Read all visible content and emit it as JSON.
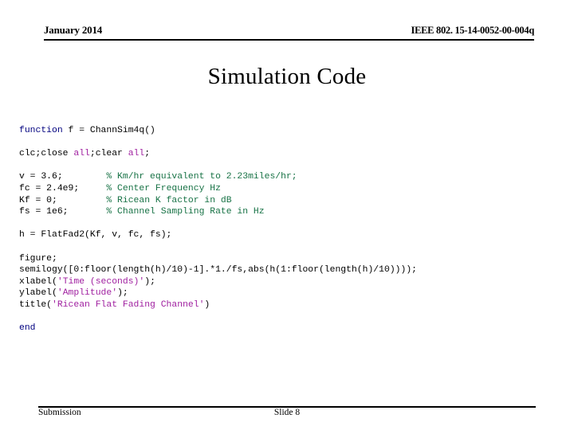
{
  "header": {
    "date": "January 2014",
    "doc_id": "IEEE 802. 15-14-0052-00-004q"
  },
  "title": "Simulation Code",
  "code": {
    "lines": [
      {
        "type": "code",
        "spans": [
          {
            "text": "function",
            "style": "kw"
          },
          {
            "text": " f = ChannSim4q()",
            "style": "plain"
          }
        ]
      },
      {
        "type": "blank"
      },
      {
        "type": "code",
        "spans": [
          {
            "text": "clc;close ",
            "style": "plain"
          },
          {
            "text": "all",
            "style": "str"
          },
          {
            "text": ";clear ",
            "style": "plain"
          },
          {
            "text": "all",
            "style": "str"
          },
          {
            "text": ";",
            "style": "plain"
          }
        ]
      },
      {
        "type": "blank"
      },
      {
        "type": "code",
        "spans": [
          {
            "text": "v = 3.6;        ",
            "style": "plain"
          },
          {
            "text": "% Km/hr equivalent to 2.23miles/hr;",
            "style": "cmt"
          }
        ]
      },
      {
        "type": "code",
        "spans": [
          {
            "text": "fc = 2.4e9;     ",
            "style": "plain"
          },
          {
            "text": "% Center Frequency Hz",
            "style": "cmt"
          }
        ]
      },
      {
        "type": "code",
        "spans": [
          {
            "text": "Kf = 0;         ",
            "style": "plain"
          },
          {
            "text": "% Ricean K factor in dB",
            "style": "cmt"
          }
        ]
      },
      {
        "type": "code",
        "spans": [
          {
            "text": "fs = 1e6;       ",
            "style": "plain"
          },
          {
            "text": "% Channel Sampling Rate in Hz",
            "style": "cmt"
          }
        ]
      },
      {
        "type": "blank"
      },
      {
        "type": "code",
        "spans": [
          {
            "text": "h = FlatFad2(Kf, v, fc, fs);",
            "style": "plain"
          }
        ]
      },
      {
        "type": "blank"
      },
      {
        "type": "code",
        "spans": [
          {
            "text": "figure;",
            "style": "plain"
          }
        ]
      },
      {
        "type": "code",
        "spans": [
          {
            "text": "semilogy([0:floor(length(h)/10)-1].*1./fs,abs(h(1:floor(length(h)/10))));",
            "style": "plain"
          }
        ]
      },
      {
        "type": "code",
        "spans": [
          {
            "text": "xlabel(",
            "style": "plain"
          },
          {
            "text": "'Time (seconds)'",
            "style": "str"
          },
          {
            "text": ");",
            "style": "plain"
          }
        ]
      },
      {
        "type": "code",
        "spans": [
          {
            "text": "ylabel(",
            "style": "plain"
          },
          {
            "text": "'Amplitude'",
            "style": "str"
          },
          {
            "text": ");",
            "style": "plain"
          }
        ]
      },
      {
        "type": "code",
        "spans": [
          {
            "text": "title(",
            "style": "plain"
          },
          {
            "text": "'Ricean Flat Fading Channel'",
            "style": "str"
          },
          {
            "text": ")",
            "style": "plain"
          }
        ]
      },
      {
        "type": "blank"
      },
      {
        "type": "code",
        "spans": [
          {
            "text": "end",
            "style": "kw"
          }
        ]
      }
    ]
  },
  "footer": {
    "left": "Submission",
    "center": "Slide 8"
  },
  "colors": {
    "keyword": "#00007f",
    "string": "#a020a0",
    "comment": "#177245",
    "text": "#000000",
    "background": "#ffffff"
  }
}
